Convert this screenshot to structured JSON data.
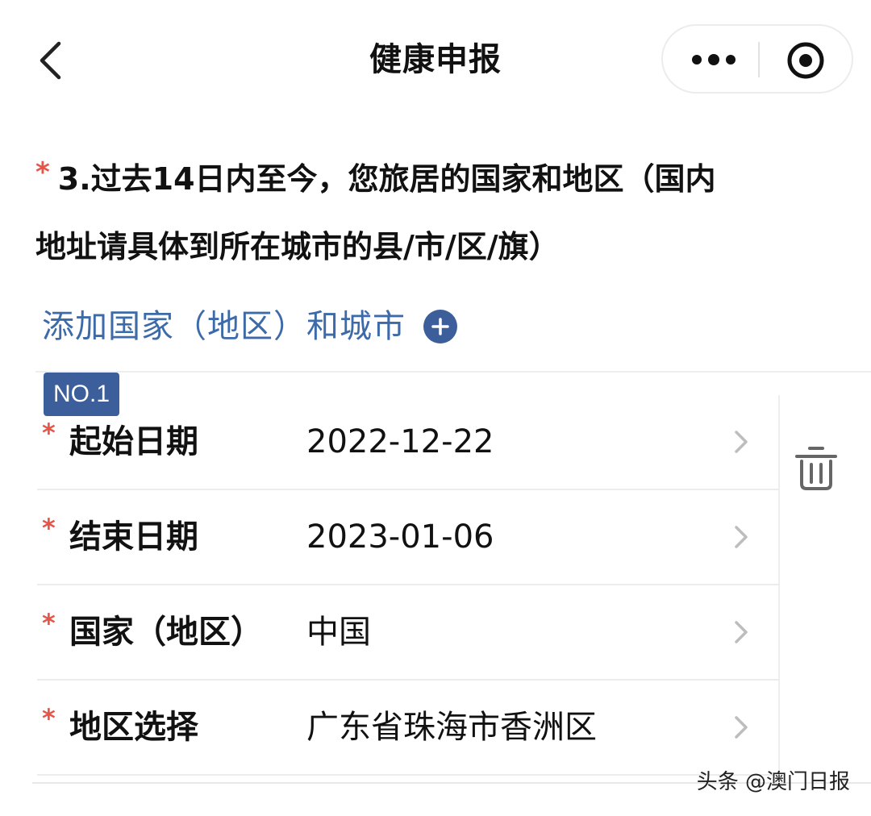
{
  "nav": {
    "title": "健康申报",
    "back_icon": "chevron-left-icon",
    "more_icon": "more-dots-icon",
    "close_icon": "target-circle-icon"
  },
  "question": {
    "required_mark": "*",
    "line1": "3.过去14日内至今，您旅居的国家和地区（国内",
    "line2": "地址请具体到所在城市的县/市/区/旗）"
  },
  "add_entry": {
    "label": "添加国家（地区）和城市",
    "icon": "plus-circle-icon"
  },
  "entry": {
    "badge": "NO.1",
    "delete_icon": "trash-icon",
    "rows": [
      {
        "required_mark": "*",
        "label": "起始日期",
        "value": "2022-12-22"
      },
      {
        "required_mark": "*",
        "label": "结束日期",
        "value": "2023-01-06"
      },
      {
        "required_mark": "*",
        "label": "国家（地区）",
        "value": "中国"
      },
      {
        "required_mark": "*",
        "label": "地区选择",
        "value": "广东省珠海市香洲区"
      }
    ]
  },
  "watermark": "头条 @澳门日报",
  "colors": {
    "accent": "#3c5f9c",
    "link": "#3d6aa8",
    "required": "#e5554a"
  }
}
